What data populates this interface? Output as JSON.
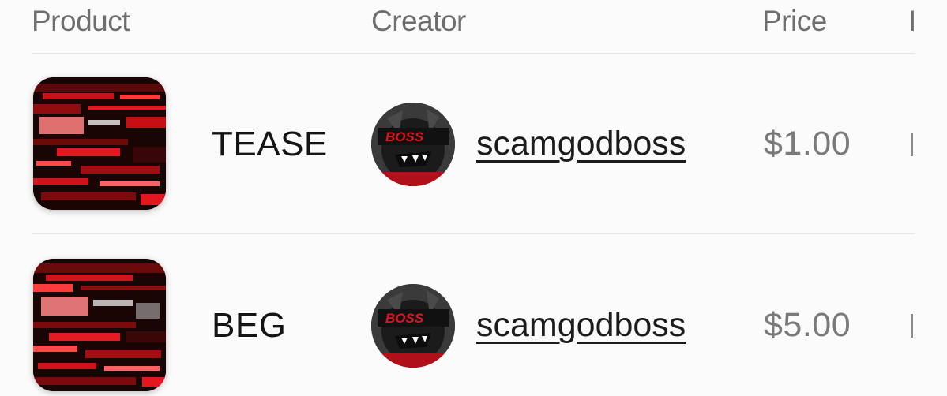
{
  "table": {
    "columns": [
      "Product",
      "Creator",
      "Price",
      "I"
    ],
    "rows": [
      {
        "product": "TEASE",
        "thumbnail_icon": "red-glitch-thumbnail",
        "creator": "scamgodboss",
        "avatar_icon": "boss-wolf-avatar",
        "avatar_text": "BOSS",
        "price": "$1.00",
        "extra": "I"
      },
      {
        "product": "BEG",
        "thumbnail_icon": "red-glitch-thumbnail",
        "creator": "scamgodboss",
        "avatar_icon": "boss-wolf-avatar",
        "avatar_text": "BOSS",
        "price": "$5.00",
        "extra": "I"
      }
    ]
  },
  "colors": {
    "background": "#fbfbfb",
    "header_text": "#6e6e6e",
    "body_text": "#141414",
    "price_text": "#7a7a7a",
    "accent_red": "#e0141c"
  }
}
